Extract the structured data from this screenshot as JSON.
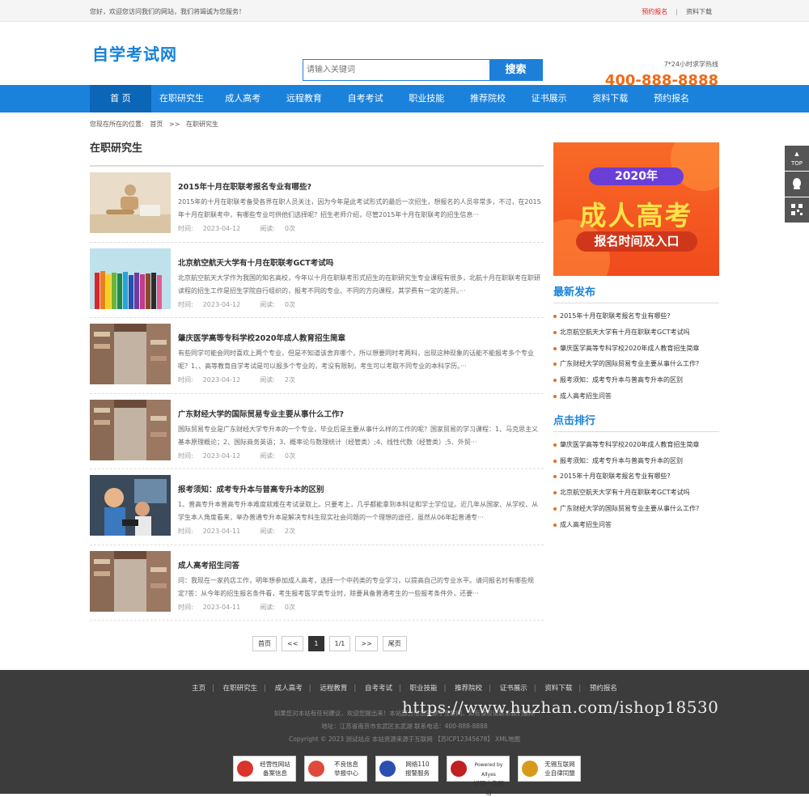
{
  "topbar": {
    "welcome": "您好，欢迎您访问我们的网站，我们将竭诚为您服务！",
    "link_signup": "预约报名",
    "link_download": "资料下载"
  },
  "header": {
    "logo": "自学考试网",
    "search_placeholder": "请输入关键词",
    "search_button": "搜索",
    "hotline_label": "7*24小时求学热线",
    "hotline_number": "400-888-8888"
  },
  "nav": [
    "首 页",
    "在职研究生",
    "成人高考",
    "远程教育",
    "自考考试",
    "职业技能",
    "推荐院校",
    "证书展示",
    "资料下载",
    "预约报名"
  ],
  "breadcrumb": {
    "prefix": "您现在所在的位置:",
    "home": "首页",
    "sep": ">>",
    "current": "在职研究生"
  },
  "main": {
    "heading": "在职研究生",
    "time_label": "时间:",
    "read_label": "阅读:",
    "articles": [
      {
        "title": "2015年十月在职联考报名专业有哪些?",
        "desc": "2015年的十月在职联考备受各界在职人员关注，因为今年是此考试形式的最后一次招生，想报名的人员非常多，不过，在2015年十月在职联考中，有哪些专业可供他们选择呢？招生老师介绍，尽管2015年十月在职联考的招生信息···",
        "date": "2023-04-12",
        "reads": "0次"
      },
      {
        "title": "北京航空航天大学有十月在职联考GCT考试吗",
        "desc": "北京航空航天大学作为我国的知名高校，今年以十月在职联考形式招生的在职研究生专业课程有很多，北航十月在职联考在职研读程的招生工作是招生学院自行组织的，报考不同的专业、不同的方向课程，其学费有一定的差异。···",
        "date": "2023-04-12",
        "reads": "0次"
      },
      {
        "title": "肇庆医学高等专科学校2020年成人教育招生简章",
        "desc": "有些同学可能会同时喜欢上两个专业，但是不知道该舍弃哪个，所以想要同时考两科，出现这种现象的话能不能报考多个专业呢？1、、高等教育自学考试是可以报多个专业的，考没有限制，考生可以考取不同专业的本科学历。···",
        "date": "2023-04-12",
        "reads": "2次"
      },
      {
        "title": "广东财经大学的国际贸易专业主要从事什么工作?",
        "desc": "国际贸易专业是广东财经大学专升本的一个专业，毕业后是主要从事什么样的工作的呢？国家贸易的学习课程：1、马克思主义基本原理概论；2、国际商务英语；3、概率论与数理统计（经管类）;4、线性代数（经管类）;5、外贸···",
        "date": "2023-04-12",
        "reads": "0次"
      },
      {
        "title": "报考须知：成考专升本与普高专升本的区别",
        "desc": "1、普高专升本普高专升本难度就难在考试录取上。只要考上，几乎都能拿到本科证和学士学位证。近几年从国家、从学校、从学生本人角度看来，举办普通专升本是解决专科生现实社会问题的一个理想的途径，虽然从06年起普通专···",
        "date": "2023-04-11",
        "reads": "2次"
      },
      {
        "title": "成人高考招生问答",
        "desc": "问：我现在一家药店工作，明年想参加成人高考，选择一个中药类的专业学习，以提高自己的专业水平。请问报名时有哪些规定?答：从今年的招生报名条件看，考生报考医学类专业时，除要具备普通考生的一些报考条件外，还要···",
        "date": "2023-04-11",
        "reads": "0次"
      }
    ]
  },
  "pager": [
    "首页",
    "<<",
    "1",
    "1/1",
    ">>",
    "尾页"
  ],
  "side": {
    "banner_year": "2020年",
    "banner_title": "成人高考",
    "banner_sub": "报名时间及入口",
    "latest_title": "最新发布",
    "latest": [
      "2015年十月在职联考报名专业有哪些?",
      "北京航空航天大学有十月在职联考GCT考试吗",
      "肇庆医学高等专科学校2020年成人教育招生简章",
      "广东财经大学的国际贸易专业主要从事什么工作?",
      "报考须知：成考专升本与普高专升本的区别",
      "成人高考招生问答"
    ],
    "hot_title": "点击排行",
    "hot": [
      "肇庆医学高等专科学校2020年成人教育招生简章",
      "报考须知：成考专升本与普高专升本的区别",
      "2015年十月在职联考报名专业有哪些?",
      "北京航空航天大学有十月在职联考GCT考试吗",
      "广东财经大学的国际贸易专业主要从事什么工作?",
      "成人高考招生问答"
    ]
  },
  "float": {
    "top": "TOP"
  },
  "footer": {
    "nav": [
      "主页",
      "在职研究生",
      "成人高考",
      "远程教育",
      "自考考试",
      "职业技能",
      "推荐院校",
      "证书展示",
      "资料下载",
      "预约报名"
    ],
    "line1": "如果您对本站有任何建议，欢迎您提出来！本站部分信息来源于互联网，如有侵权请联系我们删除",
    "line2": "地址：江苏省南京市玄武区玄武湖    联系电话：400-888-8888",
    "line3": "Copyright © 2023 测试站点 本站资源来源于互联网 【苏ICP12345678】 XML地图",
    "badges": [
      {
        "l1": "经营性网站",
        "l2": "备案信息"
      },
      {
        "l1": "不良信息",
        "l2": "举报中心"
      },
      {
        "l1": "网络110",
        "l2": "报警服务"
      },
      {
        "l1": "Powered by Allyes",
        "l2": "好耶广告网络"
      },
      {
        "l1": "无锡互联网",
        "l2": "业自律同盟"
      }
    ]
  },
  "watermark": "https://www.huzhan.com/ishop18530"
}
